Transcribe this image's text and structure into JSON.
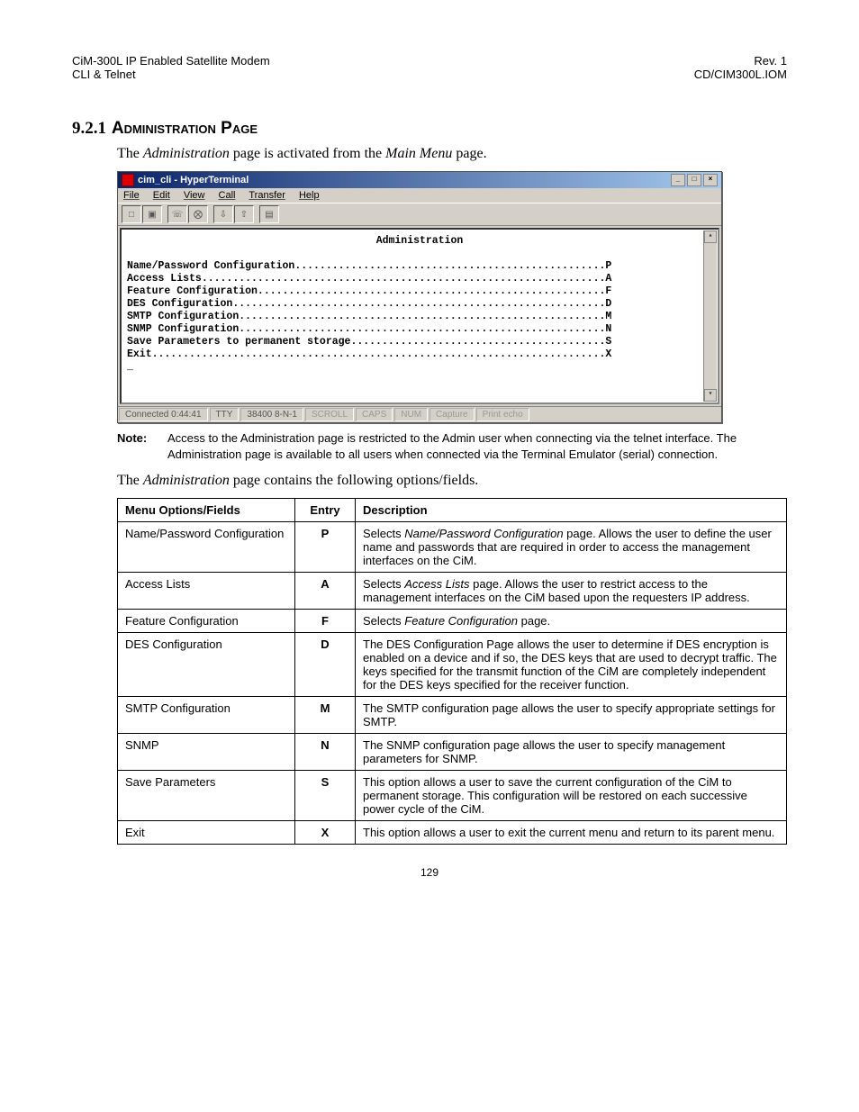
{
  "header": {
    "top_left_1": "CiM-300L IP Enabled Satellite Modem",
    "top_left_2": "CLI & Telnet",
    "top_right_1": "Rev. 1",
    "top_right_2": "CD/CIM300L.IOM"
  },
  "section": {
    "number": "9.2.1",
    "title": "Administration Page",
    "intro_pre": "The ",
    "intro_i1": "Administration",
    "intro_mid": " page is activated from the ",
    "intro_i2": "Main Menu",
    "intro_post": " page."
  },
  "hyperterm": {
    "title": "cim_cli - HyperTerminal",
    "menu": [
      "File",
      "Edit",
      "View",
      "Call",
      "Transfer",
      "Help"
    ],
    "term_heading": "Administration",
    "lines": [
      "Name/Password Configuration..................................................P",
      "Access Lists.................................................................A",
      "Feature Configuration........................................................F",
      "DES Configuration............................................................D",
      "SMTP Configuration...........................................................M",
      "SNMP Configuration...........................................................N",
      "",
      "Save Parameters to permanent storage.........................................S",
      "Exit.........................................................................X",
      "_"
    ],
    "status": {
      "connected": "Connected 0:44:41",
      "mode": "TTY",
      "baud": "38400 8-N-1",
      "scroll": "SCROLL",
      "caps": "CAPS",
      "num": "NUM",
      "capture": "Capture",
      "printecho": "Print echo"
    }
  },
  "note": {
    "label": "Note:",
    "text": "Access to the Administration page is restricted to the Admin user when connecting via the telnet interface. The Administration page is available to all users when connected via the Terminal Emulator (serial) connection."
  },
  "body_pre": "The ",
  "body_i": "Administration",
  "body_post": " page contains the following options/fields.",
  "table": {
    "h1": "Menu Options/Fields",
    "h2": "Entry",
    "h3": "Description",
    "rows": [
      {
        "name": "Name/Password Configuration",
        "entry": "P",
        "desc_pre": "Selects ",
        "desc_i": "Name/Password Configuration",
        "desc_post": " page. Allows the user to define the user name and passwords that are required in order to access the management interfaces on the CiM."
      },
      {
        "name": "Access Lists",
        "entry": "A",
        "desc_pre": "Selects ",
        "desc_i": "Access Lists",
        "desc_post": " page. Allows the user to restrict access to the management interfaces on the CiM based upon the requesters IP address."
      },
      {
        "name": "Feature Configuration",
        "entry": "F",
        "desc_pre": "Selects ",
        "desc_i": "Feature Configuration",
        "desc_post": " page."
      },
      {
        "name": "DES Configuration",
        "entry": "D",
        "desc_pre": "",
        "desc_i": "",
        "desc_post": "The DES Configuration Page allows the user to determine if DES encryption is enabled on a device and if so, the DES keys that are used to decrypt traffic. The keys specified for the transmit function of the CiM are completely independent for the DES keys specified for the receiver function."
      },
      {
        "name": "SMTP Configuration",
        "entry": "M",
        "desc_pre": "",
        "desc_i": "",
        "desc_post": "The SMTP configuration page allows the user to specify appropriate settings for SMTP."
      },
      {
        "name": "SNMP",
        "entry": "N",
        "desc_pre": "",
        "desc_i": "",
        "desc_post": "The SNMP configuration page allows the user to specify management parameters for SNMP."
      },
      {
        "name": "Save Parameters",
        "entry": "S",
        "desc_pre": "",
        "desc_i": "",
        "desc_post": "This option allows a user to save the current configuration of the CiM to permanent storage. This configuration will be restored on each successive power cycle of the CiM."
      },
      {
        "name": "Exit",
        "entry": "X",
        "desc_pre": "",
        "desc_i": "",
        "desc_post": "This option allows a user to exit the current menu and return to its parent menu."
      }
    ]
  },
  "page_number": "129"
}
